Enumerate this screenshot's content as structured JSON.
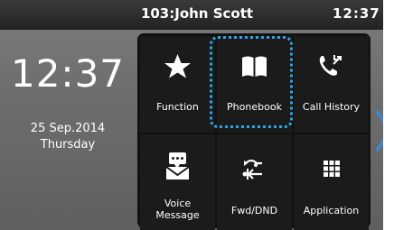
{
  "status_bar": {
    "account": "103:John Scott",
    "time": "12:37"
  },
  "idle": {
    "clock": "12:37",
    "date": "25 Sep.2014",
    "weekday": "Thursday"
  },
  "tiles": [
    {
      "label": "Function",
      "icon": "star-icon"
    },
    {
      "label": "Phonebook",
      "icon": "book-icon"
    },
    {
      "label": "Call History",
      "icon": "call-history-icon"
    },
    {
      "label": "Voice\nMessage",
      "icon": "voicemail-icon"
    },
    {
      "label": "Fwd/DND",
      "icon": "forward-dnd-icon"
    },
    {
      "label": "Application",
      "icon": "grid-icon"
    }
  ],
  "focused_tile": "Phonebook",
  "colors": {
    "focus": "#2aa7e6",
    "arrow": "#3f86c8"
  }
}
